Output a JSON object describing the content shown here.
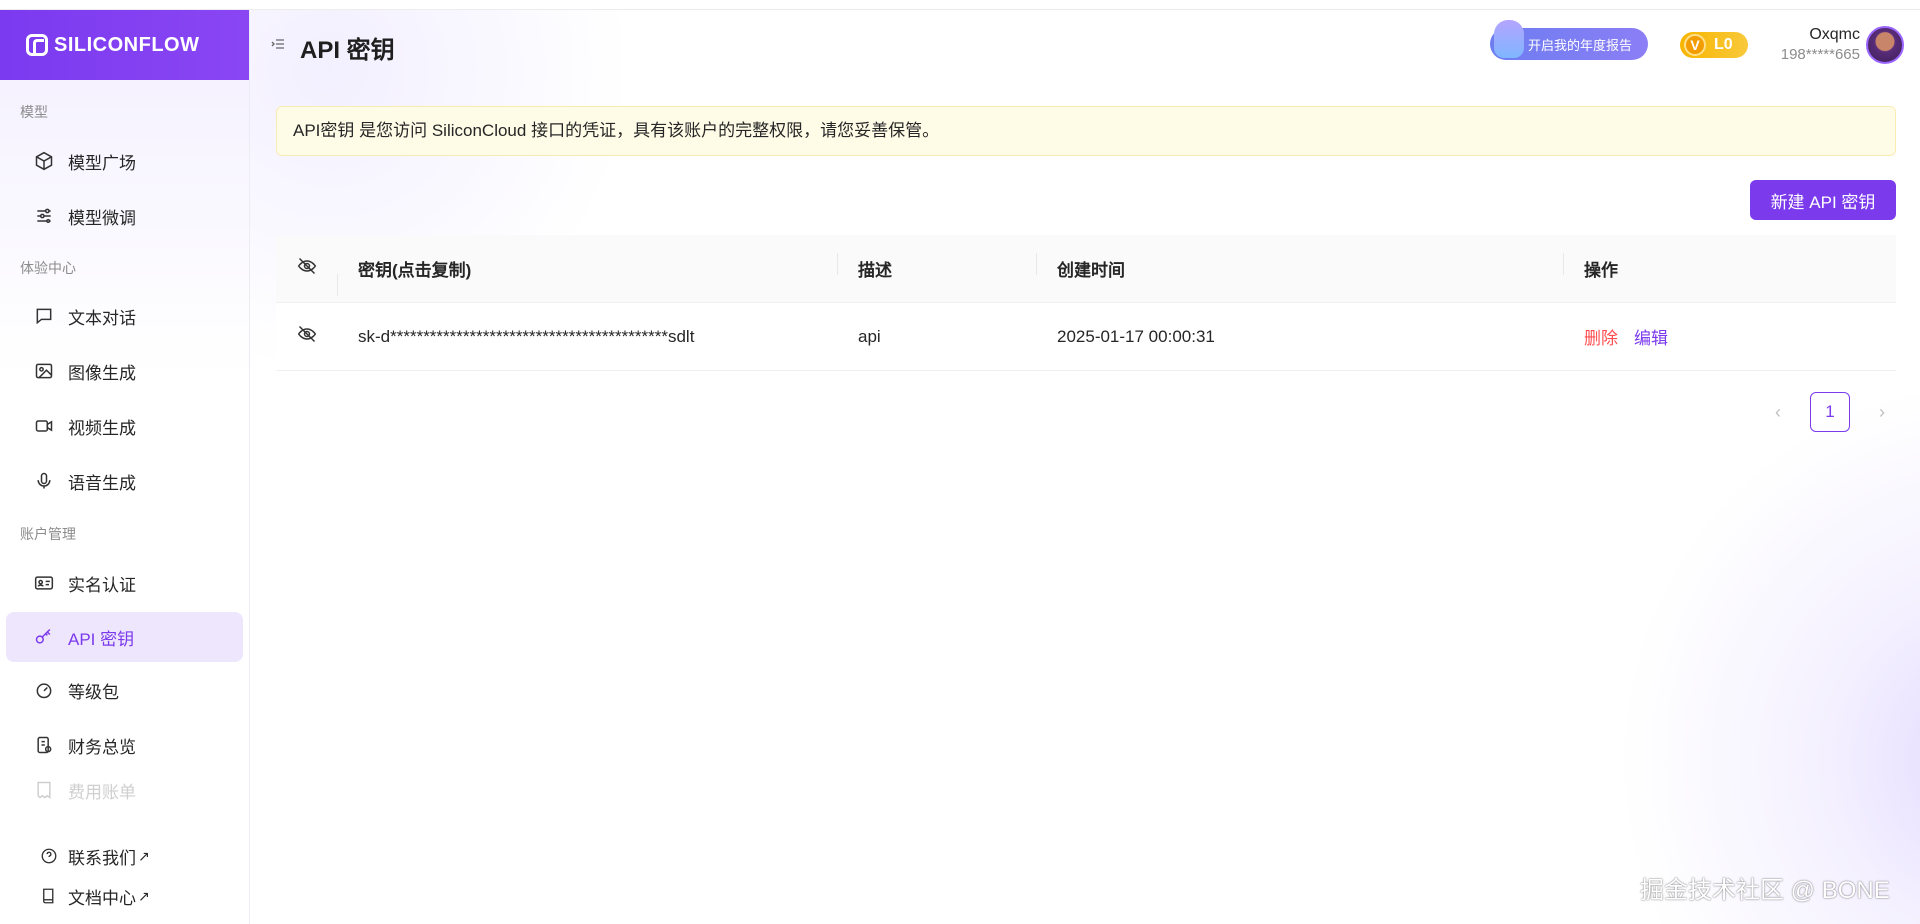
{
  "brand": {
    "logo_text": "SILICONFLOW"
  },
  "sidebar": {
    "sections": [
      {
        "label": "模型"
      },
      {
        "label": "体验中心"
      },
      {
        "label": "账户管理"
      }
    ],
    "items": [
      {
        "label": "模型广场",
        "icon": "cube-icon"
      },
      {
        "label": "模型微调",
        "icon": "sliders-icon"
      },
      {
        "label": "文本对话",
        "icon": "chat-icon"
      },
      {
        "label": "图像生成",
        "icon": "image-icon"
      },
      {
        "label": "视频生成",
        "icon": "video-icon"
      },
      {
        "label": "语音生成",
        "icon": "microphone-icon"
      },
      {
        "label": "实名认证",
        "icon": "id-card-icon"
      },
      {
        "label": "API 密钥",
        "icon": "key-icon",
        "active": true
      },
      {
        "label": "等级包",
        "icon": "gauge-icon"
      },
      {
        "label": "财务总览",
        "icon": "finance-icon"
      },
      {
        "label": "费用账单",
        "icon": "bill-icon"
      }
    ],
    "bottom_links": [
      {
        "label": "联系我们",
        "arrow": "↗",
        "icon": "help-circle-icon"
      },
      {
        "label": "文档中心",
        "arrow": "↗",
        "icon": "book-icon"
      }
    ]
  },
  "header": {
    "title": "API 密钥",
    "annual_report": "开启我的年度报告",
    "level": "L0",
    "level_badge_letter": "V",
    "user_name": "Oxqmc",
    "user_phone": "198*****665"
  },
  "notice": "API密钥 是您访问 SiliconCloud 接口的凭证，具有该账户的完整权限，请您妥善保管。",
  "actions": {
    "new_key": "新建 API 密钥"
  },
  "table": {
    "headers": {
      "key": "密钥(点击复制)",
      "description": "描述",
      "created": "创建时间",
      "operations": "操作"
    },
    "rows": [
      {
        "key": "sk-d******************************************sdlt",
        "description": "api",
        "created": "2025-01-17 00:00:31",
        "delete": "删除",
        "edit": "编辑"
      }
    ]
  },
  "pagination": {
    "current": "1"
  },
  "watermark": "掘金技术社区 @ BONE",
  "colors": {
    "accent": "#7c3aed",
    "danger": "#ff4d4f",
    "notice_bg": "#fefbe6",
    "level_badge": "#f7b500"
  }
}
